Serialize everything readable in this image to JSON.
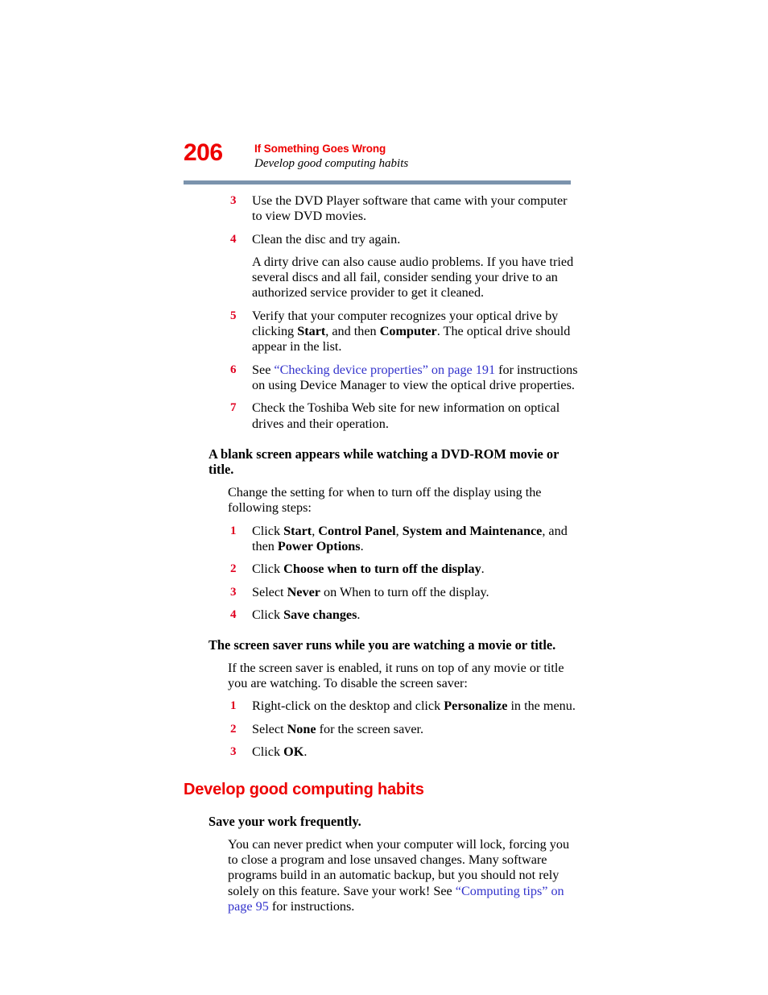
{
  "header": {
    "folio": "206",
    "chapter_title": "If Something Goes Wrong",
    "section_subtitle": "Develop good computing habits",
    "rule_color": "#7b93ad",
    "accent_red": "#ee0000",
    "number_red": "#e00020",
    "link_blue": "#3333cc"
  },
  "content": {
    "steps_optical": [
      {
        "num": "3",
        "text": "Use the DVD Player software that came with your computer to view DVD movies."
      },
      {
        "num": "4",
        "text": "Clean the disc and try again."
      }
    ],
    "dirty_drive_para": "A dirty drive can also cause audio problems. If you have tried several discs and all fail, consider sending your drive to an authorized service provider to get it cleaned.",
    "step5": {
      "num": "5",
      "part1": "Verify that your computer recognizes your optical drive by clicking ",
      "bold1": "Start",
      "part2": ", and then ",
      "bold2": "Computer",
      "part3": ". The optical drive should appear in the list."
    },
    "step6": {
      "num": "6",
      "part1": "See ",
      "link": "“Checking device properties” on page 191",
      "part2": " for instructions on using Device Manager to view the optical drive properties."
    },
    "step7": {
      "num": "7",
      "text": "Check the Toshiba Web site for new information on optical drives and their operation."
    },
    "subhead_blank_screen": "A blank screen appears while watching a DVD-ROM movie or title.",
    "change_setting_para": "Change the setting for when to turn off the display using the following steps:",
    "display_step1": {
      "num": "1",
      "part1": "Click ",
      "bold1": "Start",
      "part2": ", ",
      "bold2": "Control Panel",
      "part3": ", ",
      "bold3": "System and Maintenance",
      "part4": ", and then ",
      "bold4": "Power Options",
      "part5": "."
    },
    "display_step2": {
      "num": "2",
      "part1": "Click ",
      "bold1": "Choose when to turn off the display",
      "part2": "."
    },
    "display_step3": {
      "num": "3",
      "part1": "Select ",
      "bold1": "Never",
      "part2": " on When to turn off the display."
    },
    "display_step4": {
      "num": "4",
      "part1": "Click ",
      "bold1": "Save changes",
      "part2": "."
    },
    "subhead_screen_saver": "The screen saver runs while you are watching a movie or title.",
    "screen_saver_para": "If the screen saver is enabled, it runs on top of any movie or title you are watching. To disable the screen saver:",
    "saver_step1": {
      "num": "1",
      "part1": "Right-click on the desktop and click ",
      "bold1": "Personalize",
      "part2": " in the menu."
    },
    "saver_step2": {
      "num": "2",
      "part1": "Select ",
      "bold1": "None",
      "part2": " for the screen saver."
    },
    "saver_step3": {
      "num": "3",
      "part1": "Click ",
      "bold1": "OK",
      "part2": "."
    },
    "section_heading": "Develop good computing habits",
    "subhead_save_work": "Save your work frequently.",
    "save_work_para": {
      "part1": "You can never predict when your computer will lock, forcing you to close a program and lose unsaved changes. Many software programs build in an automatic backup, but you should not rely solely on this feature. Save your work! See ",
      "link": "“Computing tips” on page 95",
      "part2": " for instructions."
    }
  }
}
